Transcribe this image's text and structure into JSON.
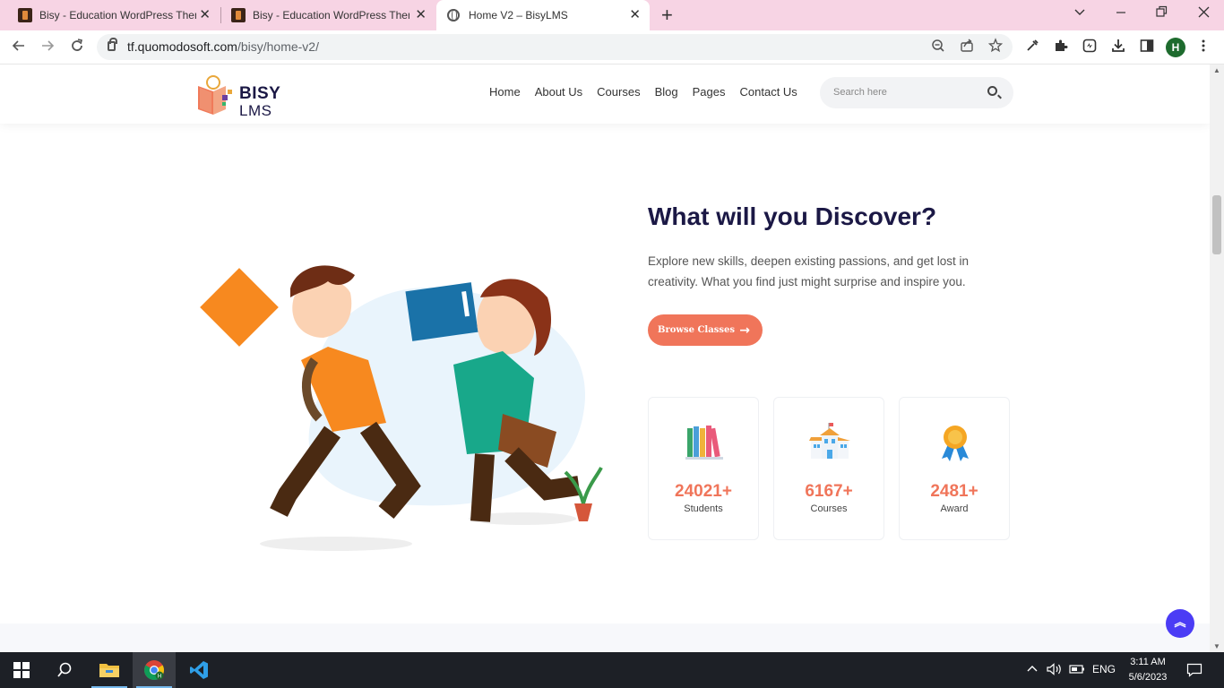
{
  "browser": {
    "tabs": [
      {
        "title": "Bisy - Education WordPress Them",
        "close": "✕"
      },
      {
        "title": "Bisy - Education WordPress Them",
        "close": "✕"
      },
      {
        "title": "Home V2 – BisyLMS",
        "close": "✕"
      }
    ],
    "new_tab": "+",
    "url_host": "tf.quomodosoft.com",
    "url_path": "/bisy/home-v2/",
    "profile_initial": "H"
  },
  "site": {
    "logo": {
      "line1": "BISY",
      "line2": "LMS"
    },
    "menu": [
      "Home",
      "About Us",
      "Courses",
      "Blog",
      "Pages",
      "Contact Us"
    ],
    "search_placeholder": "Search here",
    "discover": {
      "title": "What will you Discover?",
      "description": "Explore new skills, deepen existing passions, and get lost in creativity. What you find just might surprise and inspire you.",
      "button": "Browse Classes"
    },
    "stats": [
      {
        "value": "24021+",
        "label": "Students",
        "icon": "books-icon"
      },
      {
        "value": "6167+",
        "label": "Courses",
        "icon": "school-building-icon"
      },
      {
        "value": "2481+",
        "label": "Award",
        "icon": "award-medal-icon"
      }
    ],
    "accent": "#f0755a",
    "heading_color": "#1b1845",
    "back_to_top": "︽"
  },
  "taskbar": {
    "language": "ENG",
    "time": "3:11 AM",
    "date": "5/6/2023"
  }
}
